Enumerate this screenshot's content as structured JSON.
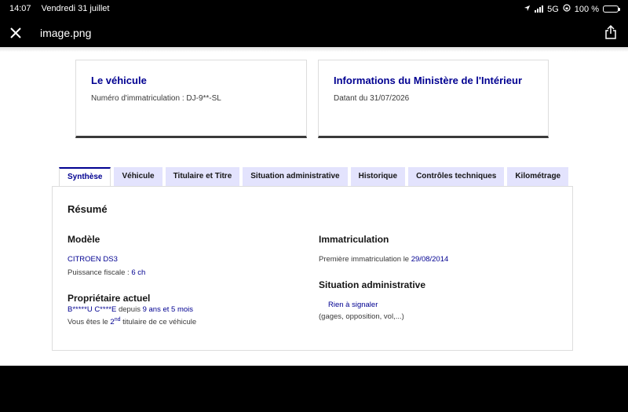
{
  "status_bar": {
    "time": "14:07",
    "date": "Vendredi 31 juillet",
    "network": "5G",
    "battery": "100 %"
  },
  "top_bar": {
    "file_name": "image.png"
  },
  "cards": {
    "vehicle": {
      "title": "Le véhicule",
      "subtitle": "Numéro d'immatriculation : DJ-9**-SL"
    },
    "ministry": {
      "title": "Informations du Ministère de l'Intérieur",
      "subtitle": "Datant du 31/07/2026"
    }
  },
  "tabs": [
    {
      "label": "Synthèse",
      "active": true
    },
    {
      "label": "Véhicule"
    },
    {
      "label": "Titulaire et Titre"
    },
    {
      "label": "Situation administrative"
    },
    {
      "label": "Historique"
    },
    {
      "label": "Contrôles techniques"
    },
    {
      "label": "Kilométrage"
    }
  ],
  "summary": {
    "title": "Résumé",
    "model": {
      "heading": "Modèle",
      "name": "CITROEN DS3",
      "power_label": "Puissance fiscale : ",
      "power_value": "6 ch"
    },
    "owner": {
      "heading": "Propriétaire actuel",
      "name": "B*****U C****E",
      "since_label": " depuis ",
      "since_value": "9 ans et 5 mois",
      "rank_prefix": "Vous êtes le ",
      "rank_num": "2",
      "rank_sup": "nd",
      "rank_suffix": " titulaire de ce véhicule"
    },
    "registration": {
      "heading": "Immatriculation",
      "label": "Première immatriculation le ",
      "date": "29/08/2014"
    },
    "admin": {
      "heading": "Situation administrative",
      "value": "Rien à signaler",
      "detail": "(gages, opposition, vol,...)"
    }
  }
}
